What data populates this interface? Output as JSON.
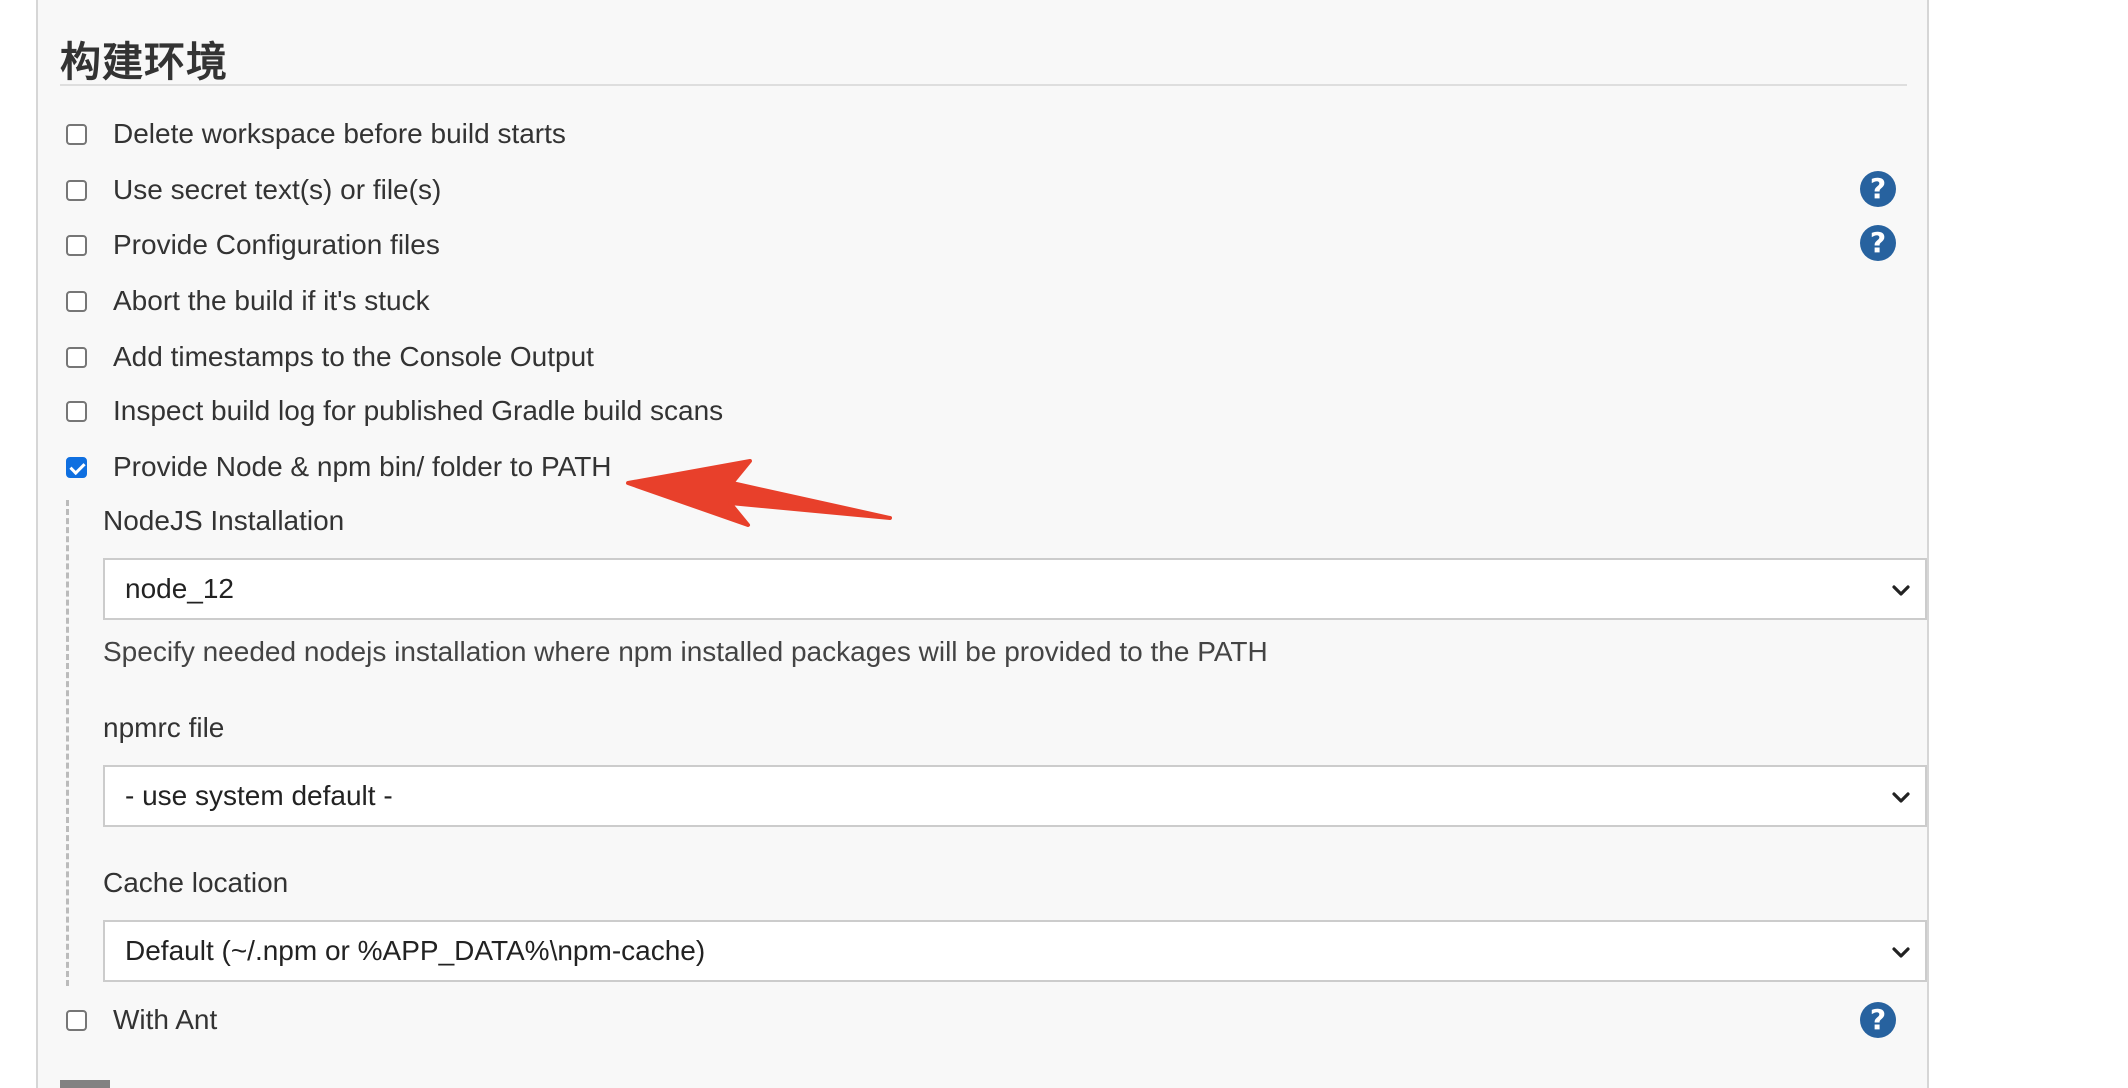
{
  "section": {
    "title": "构建环境"
  },
  "options": [
    {
      "label": "Delete workspace before build starts",
      "checked": false,
      "help": false
    },
    {
      "label": "Use secret text(s) or file(s)",
      "checked": false,
      "help": true
    },
    {
      "label": "Provide Configuration files",
      "checked": false,
      "help": true
    },
    {
      "label": "Abort the build if it's stuck",
      "checked": false,
      "help": false
    },
    {
      "label": "Add timestamps to the Console Output",
      "checked": false,
      "help": false
    },
    {
      "label": "Inspect build log for published Gradle build scans",
      "checked": false,
      "help": false
    },
    {
      "label": "Provide Node & npm bin/ folder to PATH",
      "checked": true,
      "help": false
    },
    {
      "label": "With Ant",
      "checked": false,
      "help": true
    }
  ],
  "node": {
    "installation_label": "NodeJS Installation",
    "installation_value": "node_12",
    "installation_description": "Specify needed nodejs installation where npm installed packages will be provided to the PATH",
    "npmrc_label": "npmrc file",
    "npmrc_value": "- use system default -",
    "cache_label": "Cache location",
    "cache_value": "Default (~/.npm or %APP_DATA%\\npm-cache)"
  },
  "help_glyph": "?",
  "colors": {
    "panel_background": "#f8f8f8",
    "help_icon": "#27629f",
    "checkbox_checked": "#0f6fe0",
    "annotation_arrow": "#e8402b"
  }
}
